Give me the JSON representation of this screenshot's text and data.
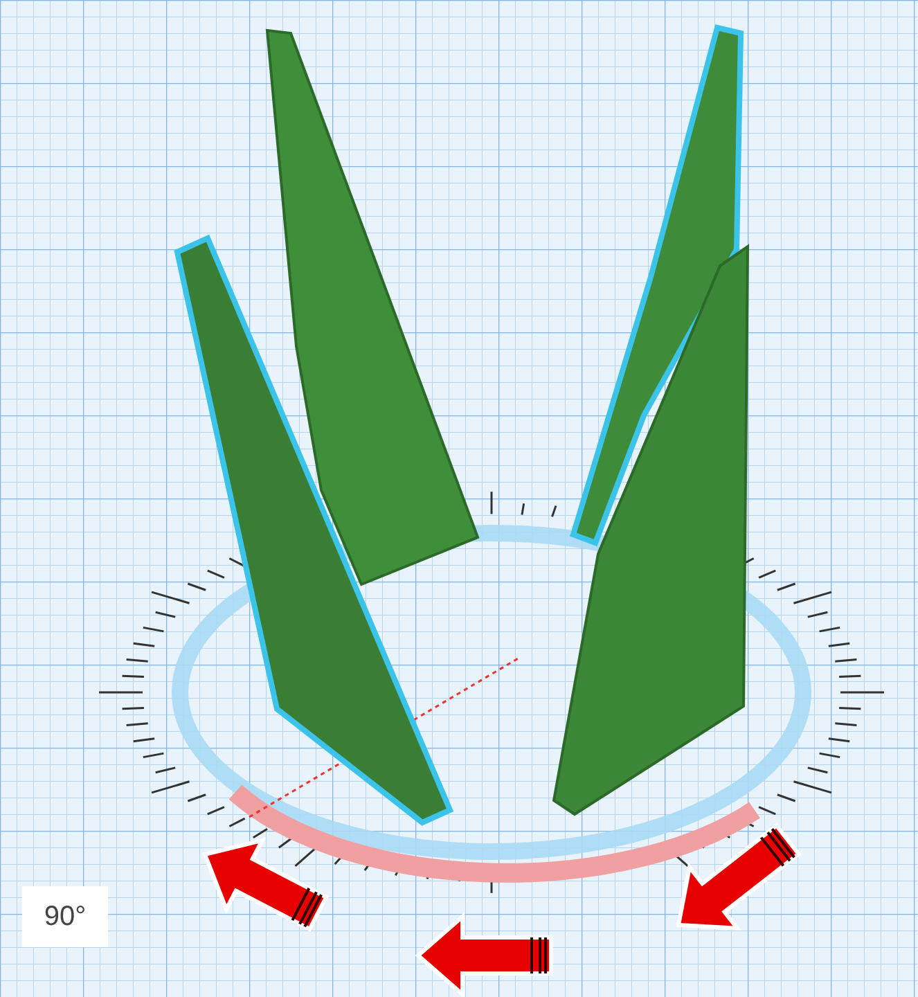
{
  "rotation_readout": {
    "text": "90°"
  }
}
